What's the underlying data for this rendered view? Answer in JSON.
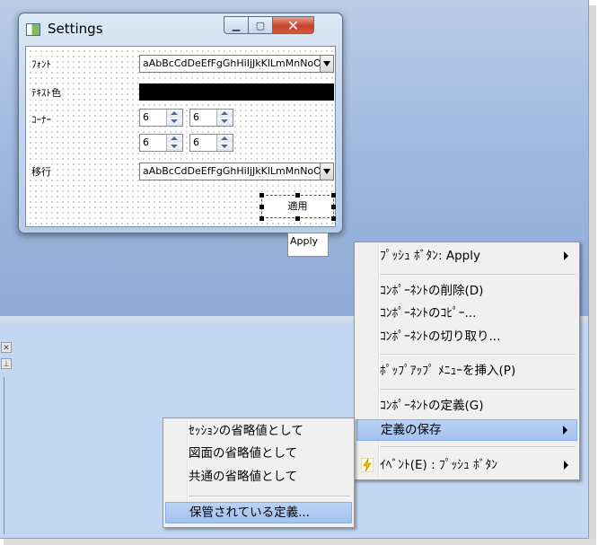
{
  "window": {
    "title": "Settings",
    "close_glyph": "✕",
    "maximize_glyph": "▢",
    "minimize_glyph": "▁",
    "icon": "window-app-icon"
  },
  "form": {
    "font_label": "ﾌｫﾝﾄ",
    "font_value": "aAbBcCdDeEfFgGhHiIjJkKlLmMnNoOpP",
    "text_color_label": "ﾃｷｽﾄ色",
    "text_color_value": "#000000",
    "corner_label": "ｺｰﾅｰ",
    "corner_values": [
      "6",
      "6",
      "6",
      "6"
    ],
    "shift_label": "移行",
    "shift_value": "aAbBcCdDeEfFgGhHiIjJkKlLmMnNoOpP",
    "apply_button": "適用"
  },
  "tooltip": "Apply",
  "context_menu": {
    "items": [
      {
        "label": "ﾌﾟｯｼｭ ﾎﾞﾀﾝ: Apply",
        "submenu": true
      },
      {
        "label": "ｺﾝﾎﾟｰﾈﾝﾄの削除(D)"
      },
      {
        "label": "ｺﾝﾎﾟｰﾈﾝﾄのｺﾋﾟｰ..."
      },
      {
        "label": "ｺﾝﾎﾟｰﾈﾝﾄの切り取り..."
      },
      {
        "label": "ﾎﾟｯﾌﾟｱｯﾌﾟ ﾒﾆｭｰを挿入(P)"
      },
      {
        "label": "ｺﾝﾎﾟｰﾈﾝﾄの定義(G)"
      },
      {
        "label": "定義の保存",
        "submenu": true,
        "highlighted": true
      },
      {
        "label": "ｲﾍﾞﾝﾄ(E) : ﾌﾟｯｼｭ ﾎﾞﾀﾝ",
        "submenu": true,
        "icon": "lightning-icon"
      }
    ]
  },
  "submenu": {
    "items": [
      {
        "label": "ｾｯｼｮﾝの省略値として"
      },
      {
        "label": "図面の省略値として"
      },
      {
        "label": "共通の省略値として"
      },
      {
        "label": "保管されている定義...",
        "highlighted": true
      }
    ]
  },
  "side_panel": {
    "close_glyph": "✕",
    "pin_glyph": "⊥"
  },
  "colors": {
    "highlight": "#a4c2ef",
    "menu_bg": "#f0f0f0",
    "close_red": "#c8412a"
  }
}
